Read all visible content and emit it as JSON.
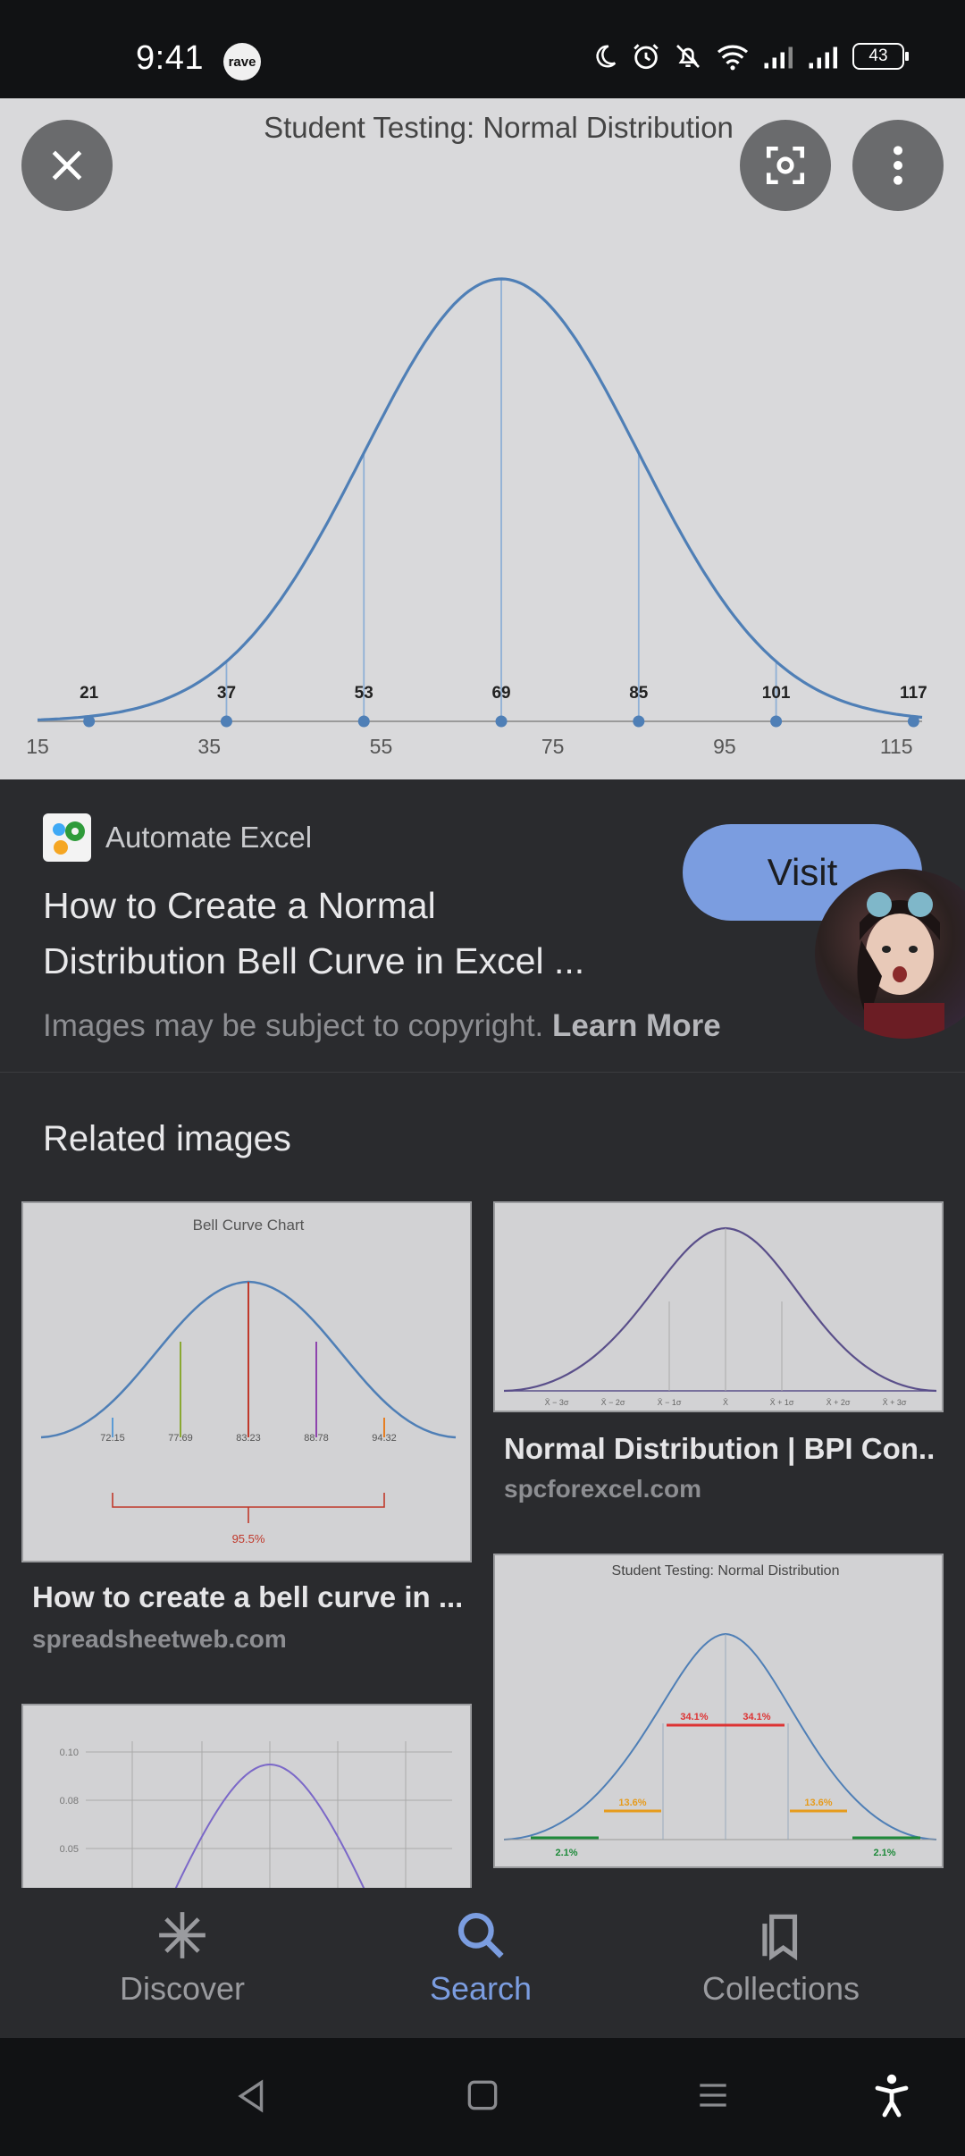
{
  "status_bar": {
    "time": "9:41",
    "notification_badge": "rave",
    "battery": "43",
    "icons": [
      "moon-icon",
      "alarm-icon",
      "bell-off-icon",
      "wifi-icon",
      "signal-icon",
      "signal-icon"
    ]
  },
  "viewer": {
    "chart_title": "Student Testing: Normal Distribution",
    "close_icon": "close-icon",
    "lens_icon": "lens-icon",
    "menu_icon": "more-vert-icon"
  },
  "chart_data": {
    "type": "line",
    "title": "Student Testing: Normal Distribution",
    "mean": 69,
    "std_dev": 16,
    "marker_labels": [
      "21",
      "37",
      "53",
      "69",
      "85",
      "101",
      "117"
    ],
    "marker_values": [
      21,
      37,
      53,
      69,
      85,
      101,
      117
    ],
    "x_tick_labels": [
      "15",
      "35",
      "55",
      "75",
      "95",
      "115"
    ],
    "x_ticks": [
      15,
      35,
      55,
      75,
      95,
      115
    ],
    "xlim": [
      15,
      118
    ],
    "xlabel": "",
    "ylabel": "",
    "grid": false,
    "colors": {
      "curve": "#4f7fb6",
      "marker": "#4f7fb6",
      "axis": "#9a9a9a"
    }
  },
  "source": {
    "site_name": "Automate Excel",
    "title_line1": "How to Create a Normal",
    "title_line2": "Distribution Bell Curve in Excel ...",
    "copyright": "Images may be subject to copyright.",
    "learn_more": "Learn More",
    "visit_label": "Visit"
  },
  "related": {
    "heading": "Related images",
    "items": [
      {
        "title": "How to create a bell curve in ...",
        "domain": "spreadsheetweb.com",
        "thumb_title": "Bell Curve Chart",
        "thumb_labels": [
          "72.15",
          "77.69",
          "83.23",
          "88.78",
          "94.32"
        ],
        "thumb_brace": "95.5%"
      },
      {
        "title": "Normal Distribution | BPI Con...",
        "domain": "spcforexcel.com",
        "thumb_labels": [
          "X̄ − 3σ",
          "X̄ − 2σ",
          "X̄ − 1σ",
          "X̄",
          "X̄ + 1σ",
          "X̄ + 2σ",
          "X̄ + 3σ"
        ]
      },
      {
        "thumb_title": "Student Testing: Normal Distribution",
        "thumb_pct": [
          "34.1%",
          "34.1%",
          "13.6%",
          "13.6%",
          "2.1%",
          "2.1%"
        ]
      },
      {
        "thumb_ticks": [
          "0.10",
          "0.08",
          "0.05"
        ]
      }
    ]
  },
  "bottom_nav": {
    "items": [
      {
        "label": "Discover",
        "icon": "asterisk-icon",
        "active": false
      },
      {
        "label": "Search",
        "icon": "search-icon",
        "active": true
      },
      {
        "label": "Collections",
        "icon": "collections-icon",
        "active": false
      }
    ],
    "active_color": "#7b9de0",
    "inactive_color": "#9a9b9f"
  },
  "system_nav": {
    "icons": [
      "back-icon",
      "home-icon",
      "recents-icon",
      "accessibility-icon"
    ]
  }
}
